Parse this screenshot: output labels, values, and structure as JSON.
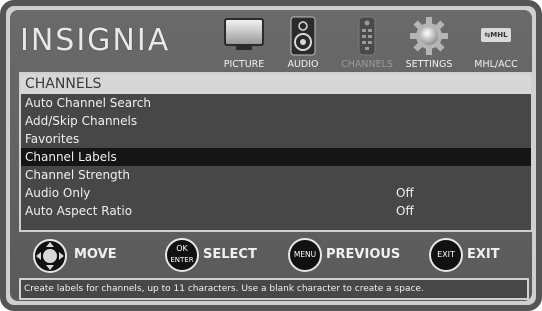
{
  "brand": "INSIGNIA",
  "nav": [
    {
      "label": "PICTURE",
      "icon": "tv-icon",
      "active": true
    },
    {
      "label": "AUDIO",
      "icon": "speaker-icon",
      "active": true
    },
    {
      "label": "CHANNELS",
      "icon": "remote-icon",
      "active": false
    },
    {
      "label": "SETTINGS",
      "icon": "gear-icon",
      "active": true
    },
    {
      "label": "MHL/ACC",
      "icon": "mhl-icon",
      "active": true,
      "icon_text": "⇆MHL"
    }
  ],
  "menu": {
    "title": "CHANNELS",
    "items": [
      {
        "label": "Auto Channel Search",
        "value": ""
      },
      {
        "label": "Add/Skip Channels",
        "value": ""
      },
      {
        "label": "Favorites",
        "value": ""
      },
      {
        "label": "Channel Labels",
        "value": "",
        "selected": true
      },
      {
        "label": "Channel Strength",
        "value": ""
      },
      {
        "label": "Audio Only",
        "value": "Off"
      },
      {
        "label": "Auto Aspect Ratio",
        "value": "Off"
      }
    ]
  },
  "controls": {
    "move_label": "MOVE",
    "select_btn_top": "OK",
    "select_btn_bottom": "ENTER",
    "select_label": "SELECT",
    "menu_btn": "MENU",
    "previous_label": "PREVIOUS",
    "exit_btn": "EXIT",
    "exit_label": "EXIT"
  },
  "help_text": "Create labels for channels, up to 11 characters. Use a blank character to create a space."
}
